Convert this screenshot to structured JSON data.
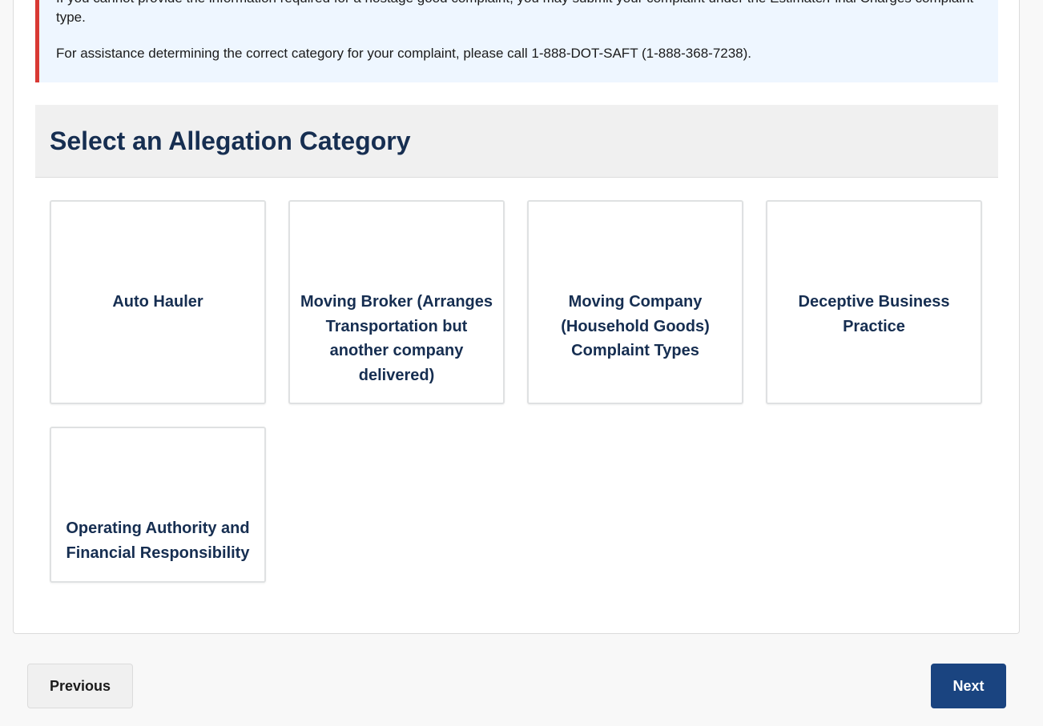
{
  "alert": {
    "line1": "If you cannot provide the information required for a hostage good complaint, you may submit your complaint under the Estimate/Final Charges complaint type.",
    "line2": "For assistance determining the correct category for your complaint, please call 1-888-DOT-SAFT (1-888-368-7238)."
  },
  "section": {
    "title": "Select an Allegation Category"
  },
  "categories": [
    {
      "label": "Auto Hauler"
    },
    {
      "label": "Moving Broker (Arranges Transportation but another company delivered)"
    },
    {
      "label": "Moving Company (Household Goods) Complaint Types"
    },
    {
      "label": "Deceptive Business Practice"
    },
    {
      "label": "Operating Authority and Financial Responsibility"
    }
  ],
  "nav": {
    "previous_label": "Previous",
    "next_label": "Next"
  },
  "colors": {
    "heading": "#162e51",
    "alert_bg": "#eef6ff",
    "alert_border": "#d83933",
    "primary_button": "#1a4480"
  }
}
